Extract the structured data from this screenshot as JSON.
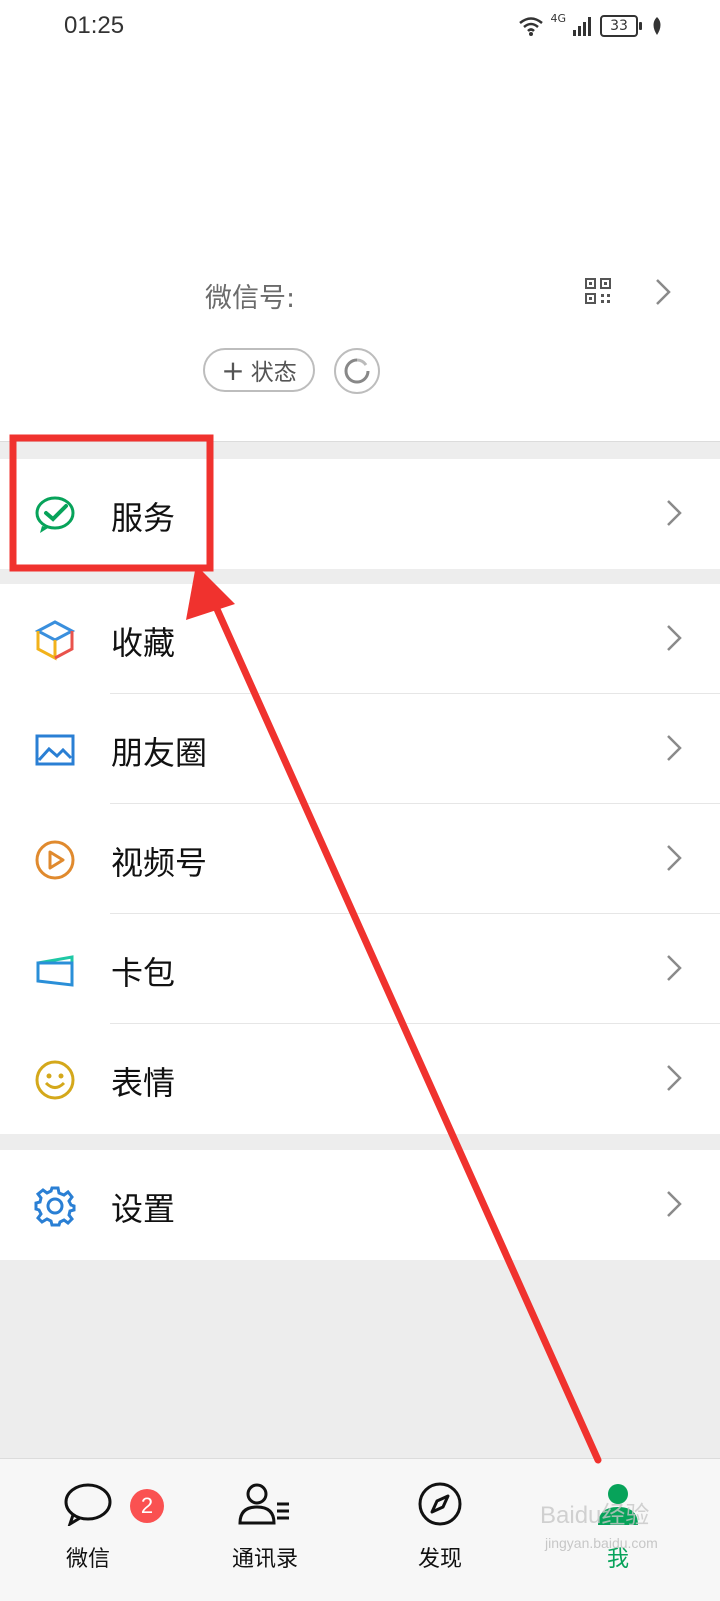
{
  "status_bar": {
    "time": "01:25",
    "network": "4G",
    "battery": "33"
  },
  "profile": {
    "wechat_id_label": "微信号:",
    "status_button_label": "状态",
    "qr_icon": "qr-code-icon",
    "refresh_icon": "refresh-icon"
  },
  "menu": {
    "service": {
      "label": "服务",
      "icon": "wechat-pay-check-icon",
      "color": "#07c160"
    },
    "items": [
      {
        "label": "收藏",
        "icon": "favorites-cube-icon"
      },
      {
        "label": "朋友圈",
        "icon": "moments-image-icon"
      },
      {
        "label": "视频号",
        "icon": "channels-play-icon"
      },
      {
        "label": "卡包",
        "icon": "card-wallet-icon"
      },
      {
        "label": "表情",
        "icon": "sticker-smile-icon"
      }
    ],
    "settings": {
      "label": "设置",
      "icon": "gear-icon"
    }
  },
  "tabbar": {
    "tabs": [
      {
        "label": "微信",
        "icon": "chat-bubble-icon",
        "badge": "2"
      },
      {
        "label": "通讯录",
        "icon": "contacts-icon"
      },
      {
        "label": "发现",
        "icon": "compass-icon"
      },
      {
        "label": "我",
        "icon": "me-person-icon",
        "active": true
      }
    ],
    "active_color": "#07c160"
  },
  "annotation": {
    "highlight_color": "#f0322e"
  },
  "watermark": {
    "text": "Baidu经验",
    "sub": "jingyan.baidu.com"
  }
}
